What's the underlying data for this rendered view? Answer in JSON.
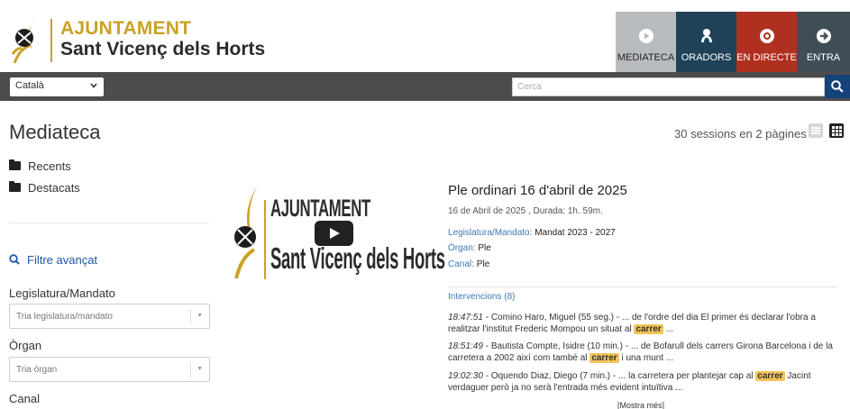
{
  "header": {
    "brand_line1": "AJUNTAMENT",
    "brand_line2": "Sant Vicenç dels Horts",
    "buttons": [
      {
        "label": "MEDIATECA",
        "icon": "play-circle-icon",
        "color": "#b9bcbf"
      },
      {
        "label": "ORADORS",
        "icon": "speaker-icon",
        "color": "#1f4258"
      },
      {
        "label": "EN DIRECTE",
        "icon": "eye-icon",
        "color": "#b0301f"
      },
      {
        "label": "ENTRA",
        "icon": "login-arrow-icon",
        "color": "#3f4d57"
      }
    ]
  },
  "nav": {
    "language": "Català",
    "search_placeholder": "Cerca"
  },
  "sidebar": {
    "title": "Mediateca",
    "folders": [
      "Recents",
      "Destacats"
    ],
    "filter_label": "Filtre avançat",
    "filters": [
      {
        "label": "Legislatura/Mandato",
        "placeholder": "Tria legislatura/mandato"
      },
      {
        "label": "Òrgan",
        "placeholder": "Tria òrgan"
      },
      {
        "label": "Canal",
        "placeholder": ""
      }
    ]
  },
  "results": {
    "count_text": "30 sessions en 2 pàgines"
  },
  "session": {
    "thumb_line1": "AJUNTAMENT",
    "thumb_line2": "Sant Vicenç dels Horts",
    "title": "Ple ordinari 16 d'abril de 2025",
    "meta": "16 de Abril de 2025 , Durada: 1h. 59m.",
    "legislatura_key": "Legislatura/Mandato:",
    "legislatura_val": "Mandat 2023 - 2027",
    "organ_key": "Òrgan:",
    "organ_val": "Ple",
    "canal_key": "Canal:",
    "canal_val": "Ple",
    "interventions_label": "Intervencions (8)",
    "hits": [
      {
        "time": "18:47:51",
        "pre": " - Comino Haro, Miguel  (55 seg.)  - ... de l'ordre del dia El primer és declarar l'obra a realitzar l'institut Frederic Mompou un situat al ",
        "term": "carrer",
        "post": " ..."
      },
      {
        "time": "18:51:49",
        "pre": " - Bautista Compte, Isidre  (10 min.)  - ... de Bofarull dels carrers Girona Barcelona i de la carretera a 2002 així com també al ",
        "term": "carrer",
        "post": " i una munt ..."
      },
      {
        "time": "19:02:30",
        "pre": " - Oquendo Diaz, Diego  (7 min.)  - ... la carretera per plantejar cap al ",
        "term": "carrer",
        "post": " Jacint verdaguer però ja no serà l'entrada més evident intuïtiva ..."
      }
    ],
    "show_more": "[Mostra més]"
  },
  "colors": {
    "brand_gold": "#c9a227",
    "navbar": "#4c4c4c",
    "search_button": "#16427a",
    "link": "#3f78b5",
    "highlight": "#f1c35a"
  }
}
